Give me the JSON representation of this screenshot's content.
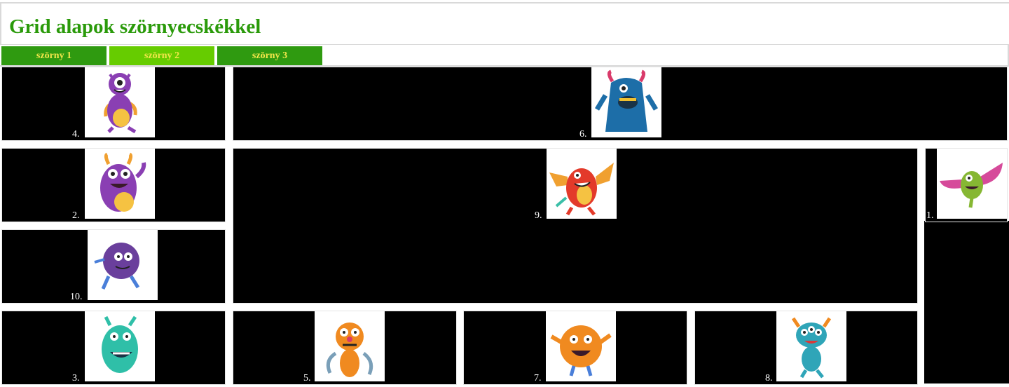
{
  "page": {
    "title": "Grid alapok szörnyecskékkel"
  },
  "nav": {
    "tabs": [
      {
        "label": "szörny 1"
      },
      {
        "label": "szörny 2"
      },
      {
        "label": "szörny 3"
      }
    ]
  },
  "colors": {
    "title": "#2a9a0a",
    "tab_dark": "#2f9a10",
    "tab_active": "#66cc00",
    "tab_text": "#f2e64a",
    "cell_bg": "#000000"
  },
  "grid": {
    "cells": [
      {
        "number": "4.",
        "image": "purple-one-eyed-monster"
      },
      {
        "number": "6.",
        "image": "blue-furry-horned-monster"
      },
      {
        "number": "2.",
        "image": "purple-horned-monster"
      },
      {
        "number": "9.",
        "image": "red-winged-dragon-monster"
      },
      {
        "number": "1.",
        "image": "green-bat-winged-monster"
      },
      {
        "number": "10.",
        "image": "purple-fuzzy-monster"
      },
      {
        "number": "3.",
        "image": "teal-horned-monster"
      },
      {
        "number": "5.",
        "image": "orange-tentacle-monster"
      },
      {
        "number": "7.",
        "image": "orange-furry-monster"
      },
      {
        "number": "8.",
        "image": "teal-three-eyed-monster"
      }
    ]
  }
}
